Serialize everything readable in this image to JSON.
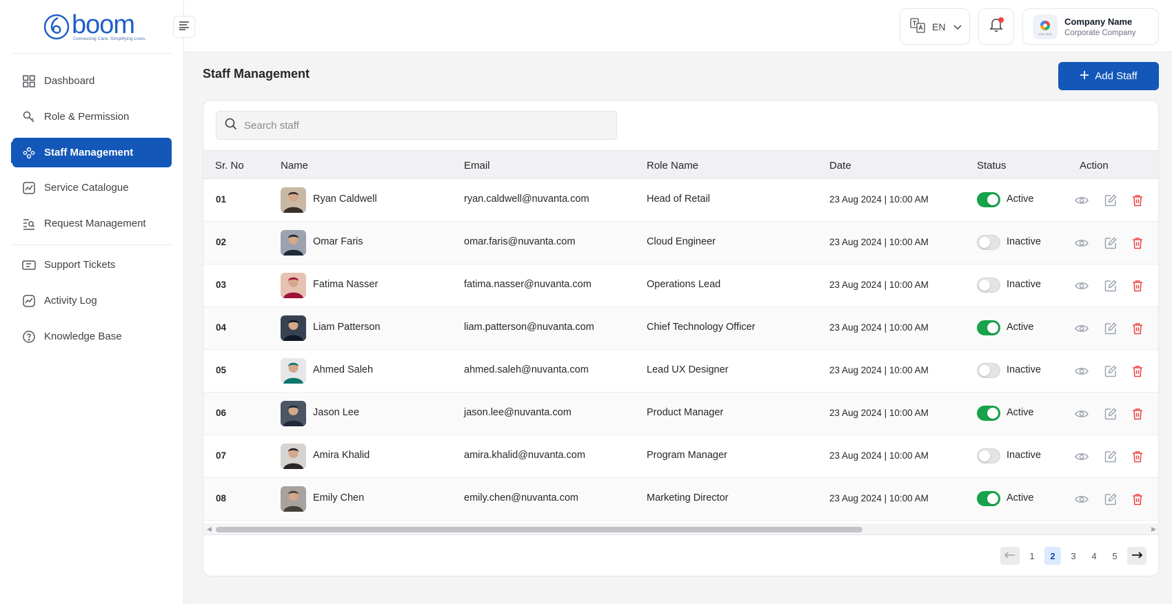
{
  "brand": {
    "name": "boom",
    "tagline": "Connecting Care. Simplifying Lives."
  },
  "sidebar": {
    "items": [
      {
        "label": "Dashboard",
        "icon": "grid-icon"
      },
      {
        "label": "Role & Permission",
        "icon": "key-icon"
      },
      {
        "label": "Staff Management",
        "icon": "people-icon",
        "active": true
      },
      {
        "label": "Service Catalogue",
        "icon": "chart-catalogue-icon"
      },
      {
        "label": "Request Management",
        "icon": "list-search-icon"
      },
      {
        "label": "Support Tickets",
        "icon": "ticket-icon"
      },
      {
        "label": "Activity Log",
        "icon": "activity-icon"
      },
      {
        "label": "Knowledge Base",
        "icon": "help-circle-icon"
      }
    ]
  },
  "header": {
    "language": "EN",
    "company_name": "Company Name",
    "company_sub": "Corporate Company",
    "company_logo_text": "LOGO TEXT"
  },
  "main": {
    "title": "Staff Management",
    "add_label": "Add Staff",
    "search_placeholder": "Search staff"
  },
  "table": {
    "headers": {
      "sr": "Sr. No",
      "name": "Name",
      "email": "Email",
      "role": "Role Name",
      "date": "Date",
      "status": "Status",
      "action": "Action"
    },
    "rows": [
      {
        "sr": "01",
        "name": "Ryan Caldwell",
        "email": "ryan.caldwell@nuvanta.com",
        "role": "Head of Retail",
        "date": "23 Aug 2024 | 10:00 AM",
        "status": "Active",
        "on": true
      },
      {
        "sr": "02",
        "name": "Omar Faris",
        "email": "omar.faris@nuvanta.com",
        "role": "Cloud Engineer",
        "date": "23 Aug 2024 | 10:00 AM",
        "status": "Inactive",
        "on": false
      },
      {
        "sr": "03",
        "name": "Fatima Nasser",
        "email": "fatima.nasser@nuvanta.com",
        "role": "Operations Lead",
        "date": "23 Aug 2024 | 10:00 AM",
        "status": "Inactive",
        "on": false
      },
      {
        "sr": "04",
        "name": "Liam Patterson",
        "email": "liam.patterson@nuvanta.com",
        "role": "Chief Technology Officer",
        "date": "23 Aug 2024 | 10:00 AM",
        "status": "Active",
        "on": true
      },
      {
        "sr": "05",
        "name": "Ahmed Saleh",
        "email": "ahmed.saleh@nuvanta.com",
        "role": "Lead UX Designer",
        "date": "23 Aug 2024 | 10:00 AM",
        "status": "Inactive",
        "on": false
      },
      {
        "sr": "06",
        "name": "Jason Lee",
        "email": "jason.lee@nuvanta.com",
        "role": "Product Manager",
        "date": "23 Aug 2024 | 10:00 AM",
        "status": "Active",
        "on": true
      },
      {
        "sr": "07",
        "name": "Amira Khalid",
        "email": "amira.khalid@nuvanta.com",
        "role": "Program Manager",
        "date": "23 Aug 2024 | 10:00 AM",
        "status": "Inactive",
        "on": false
      },
      {
        "sr": "08",
        "name": "Emily Chen",
        "email": "emily.chen@nuvanta.com",
        "role": "Marketing Director",
        "date": "23 Aug 2024 | 10:00 AM",
        "status": "Active",
        "on": true
      }
    ]
  },
  "pagination": {
    "pages": [
      "1",
      "2",
      "3",
      "4",
      "5"
    ],
    "current": "2"
  },
  "colors": {
    "primary": "#1357b8",
    "active_toggle": "#16a34a",
    "delete": "#ef4444"
  }
}
